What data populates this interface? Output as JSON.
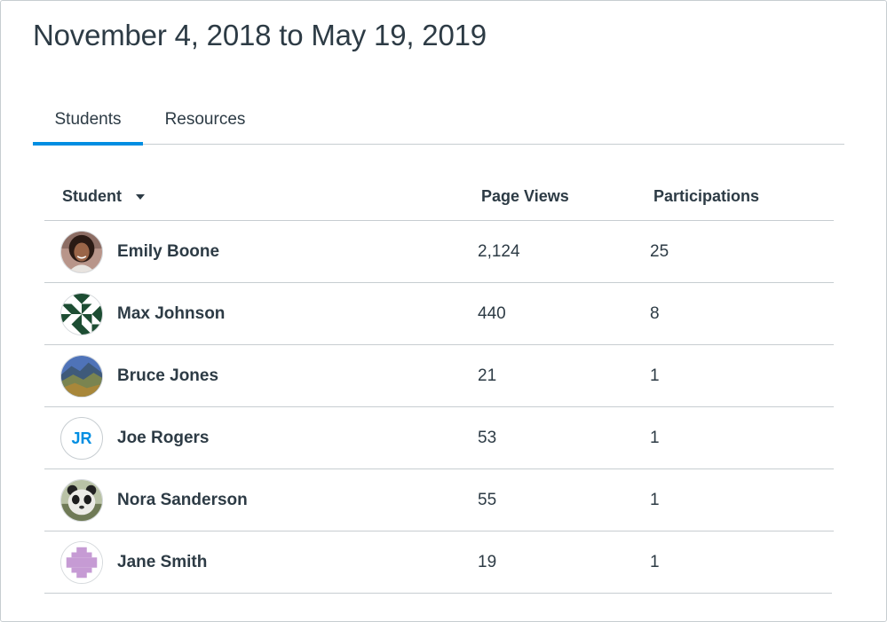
{
  "date_range": "November 4, 2018 to May 19, 2019",
  "tabs": [
    {
      "label": "Students",
      "active": true
    },
    {
      "label": "Resources",
      "active": false
    }
  ],
  "table": {
    "headers": {
      "student": "Student",
      "page_views": "Page Views",
      "participations": "Participations"
    },
    "rows": [
      {
        "name": "Emily Boone",
        "avatar": "photo-woman-icon",
        "page_views": "2,124",
        "participations": "25"
      },
      {
        "name": "Max Johnson",
        "avatar": "geometric-pattern-icon",
        "page_views": "440",
        "participations": "8"
      },
      {
        "name": "Bruce Jones",
        "avatar": "landscape-photo-icon",
        "page_views": "21",
        "participations": "1"
      },
      {
        "name": "Joe Rogers",
        "avatar_initials": "JR",
        "page_views": "53",
        "participations": "1"
      },
      {
        "name": "Nora Sanderson",
        "avatar": "panda-photo-icon",
        "page_views": "55",
        "participations": "1"
      },
      {
        "name": "Jane Smith",
        "avatar": "purple-pattern-icon",
        "page_views": "19",
        "participations": "1"
      }
    ]
  },
  "colors": {
    "accent": "#008ee2",
    "text": "#2d3b45",
    "border": "#c7cdd1"
  }
}
